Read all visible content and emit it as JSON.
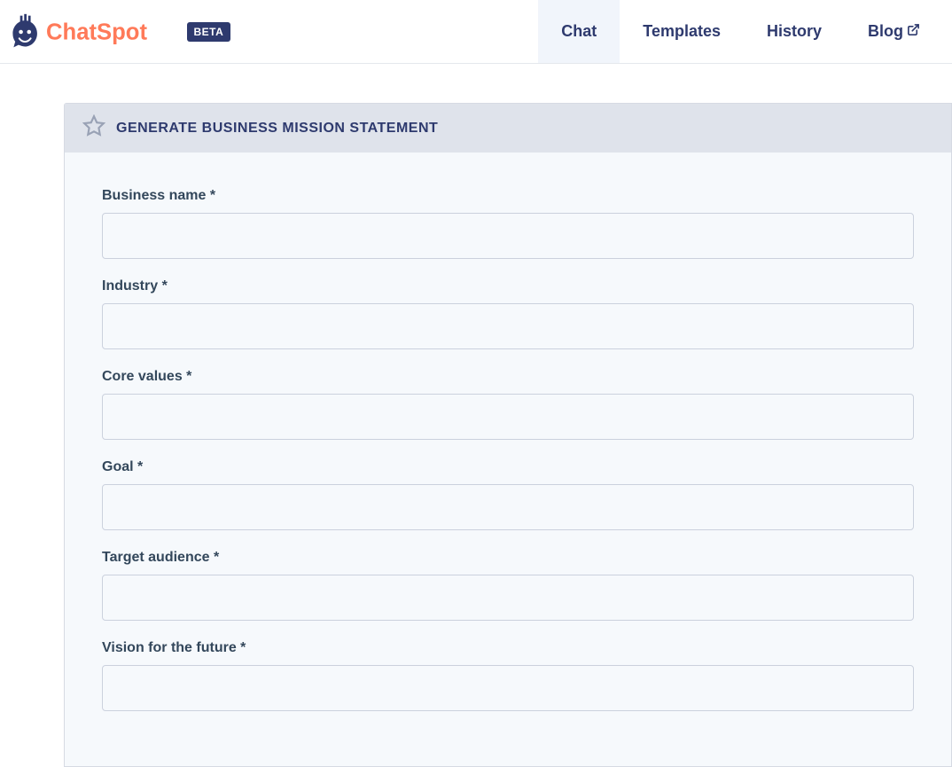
{
  "header": {
    "brand": "ChatSpot",
    "badge": "BETA"
  },
  "nav": {
    "items": [
      {
        "label": "Chat",
        "active": true
      },
      {
        "label": "Templates",
        "active": false
      },
      {
        "label": "History",
        "active": false
      },
      {
        "label": "Blog",
        "active": false,
        "external": true
      }
    ]
  },
  "card": {
    "title": "GENERATE BUSINESS MISSION STATEMENT"
  },
  "form": {
    "fields": [
      {
        "label": "Business name *",
        "value": ""
      },
      {
        "label": "Industry *",
        "value": ""
      },
      {
        "label": "Core values *",
        "value": ""
      },
      {
        "label": "Goal *",
        "value": ""
      },
      {
        "label": "Target audience *",
        "value": ""
      },
      {
        "label": "Vision for the future *",
        "value": ""
      }
    ]
  }
}
